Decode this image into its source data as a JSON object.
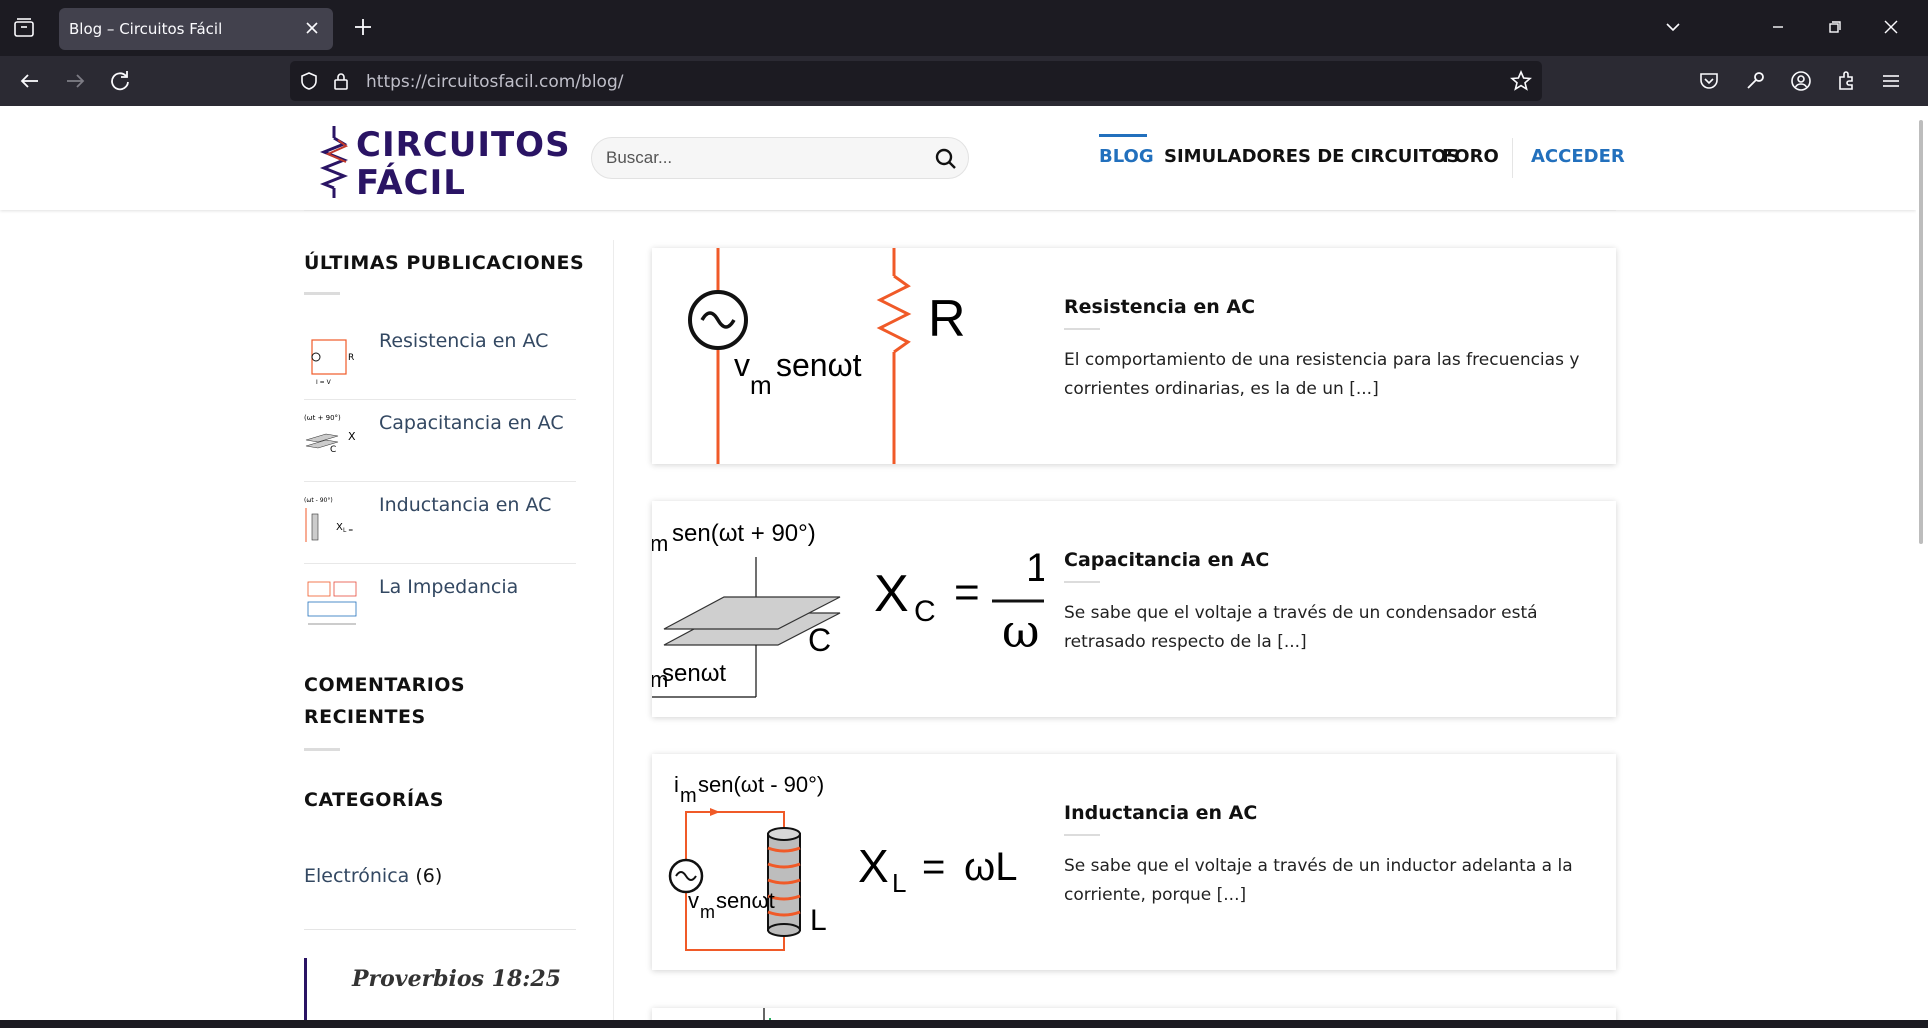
{
  "browser": {
    "tab_title": "Blog – Circuitos Fácil",
    "url_host": "https://circuitosfacil.com",
    "url_path": "/blog/"
  },
  "site": {
    "logo_line1": "CIRCUITOS",
    "logo_line2": "FÁCIL",
    "search_placeholder": "Buscar...",
    "menu": {
      "blog": "BLOG",
      "simuladores": "SIMULADORES DE CIRCUITOS",
      "foro": "FORO",
      "acceder": "ACCEDER"
    }
  },
  "sidebar": {
    "recent_heading": "ÚLTIMAS PUBLICACIONES",
    "recent": [
      {
        "label": "Resistencia en AC"
      },
      {
        "label": "Capacitancia en AC"
      },
      {
        "label": "Inductancia en AC"
      },
      {
        "label": "La Impedancia"
      }
    ],
    "comments_heading_1": "COMENTARIOS",
    "comments_heading_2": "RECIENTES",
    "categories_heading": "CATEGORÍAS",
    "category_name": "Electrónica",
    "category_count": "(6)",
    "quote": "Proverbios 18:25"
  },
  "posts": [
    {
      "title": "Resistencia en AC",
      "excerpt": "El comportamiento de una resistencia para las frecuencias y corrientes ordinarias, es la de un [...]",
      "img": {
        "label_v": "v",
        "label_m": "m",
        "label_rest": "senωt",
        "label_r": "R"
      }
    },
    {
      "title": "Capacitancia en AC",
      "excerpt": "Se sabe que el voltaje a través de un condensador está retrasado respecto de la [...]",
      "img": {
        "top": "sen(ωt + 90°)",
        "top_m": "m",
        "bottom": "senωt",
        "bottom_m": "m",
        "xc": "X",
        "xc_sub": "C",
        "eq": "=",
        "one": "1",
        "omega": "ω",
        "c": "C"
      }
    },
    {
      "title": "Inductancia en AC",
      "excerpt": "Se sabe que el voltaje a través de un inductor adelanta a la corriente, porque [...]",
      "img": {
        "top_i": "i",
        "top_m": "m",
        "top": "sen(ωt - 90°)",
        "v": "v",
        "v_m": "m",
        "v_rest": "senωt",
        "xl": "X",
        "xl_sub": "L",
        "eq": "=",
        "wl": "ωL",
        "l": "L"
      }
    }
  ],
  "colors": {
    "brand": "#2a1464",
    "link": "#334862",
    "active": "#2270bd",
    "wire": "#f05a28"
  }
}
